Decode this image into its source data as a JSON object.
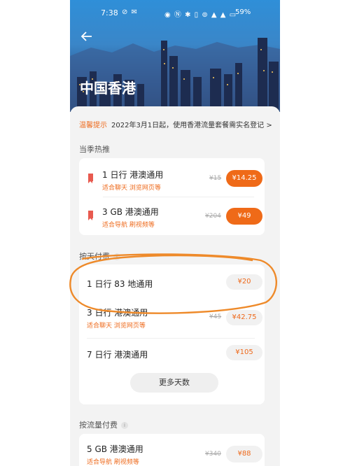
{
  "status": {
    "time": "7:38",
    "battery": "59%"
  },
  "header": {
    "title": "中国香港"
  },
  "notice": {
    "label": "温馨提示",
    "text": "2022年3月1日起，使用香港流量套餐需实名登记 >"
  },
  "sections": {
    "hot": "当季热推",
    "by_day": "按天付费",
    "by_data": "按流量付费",
    "info_glyph": "i"
  },
  "hot_items": [
    {
      "name": "1 日行  港澳通用",
      "desc": "适合聊天 浏览网页等",
      "orig": "¥15",
      "price": "¥14.25"
    },
    {
      "name": "3 GB  港澳通用",
      "desc": "适合导航 刷视频等",
      "orig": "¥204",
      "price": "¥49"
    }
  ],
  "day_items": [
    {
      "name": "1 日行  83 地通用",
      "price": "¥20"
    },
    {
      "name": "3 日行  港澳通用",
      "desc": "适合聊天 浏览网页等",
      "orig": "¥45",
      "price": "¥42.75"
    },
    {
      "name": "7 日行  港澳通用",
      "price": "¥105"
    }
  ],
  "more_button": "更多天数",
  "data_items": [
    {
      "name": "5 GB  港澳通用",
      "desc": "适合导航 刷视频等",
      "orig": "¥340",
      "price": "¥88"
    }
  ],
  "colors": {
    "accent": "#ef6a18",
    "annotation": "#ee8a2a"
  }
}
